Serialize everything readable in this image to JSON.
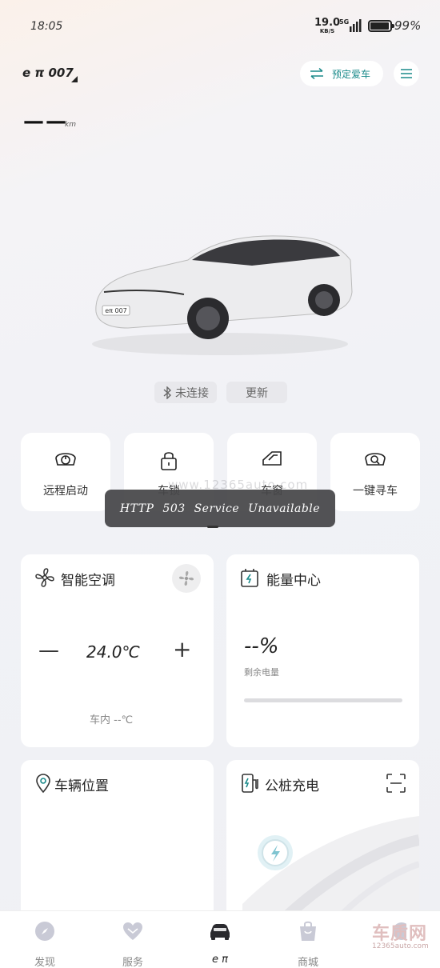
{
  "status_bar": {
    "time": "18:05",
    "net_speed": "19.0",
    "net_speed_unit": "KB/S",
    "network": "5G",
    "battery_pct": "99%"
  },
  "header": {
    "car_name": "e π 007",
    "reserve_label": "预定爱车",
    "range_value": "——",
    "range_unit": "km"
  },
  "connection": {
    "status_label": "未连接",
    "refresh_label": "更新"
  },
  "quick_actions": [
    {
      "label": "远程启动",
      "icon": "remote-start-icon"
    },
    {
      "label": "车锁",
      "icon": "lock-icon"
    },
    {
      "label": "车窗",
      "icon": "window-icon"
    },
    {
      "label": "一键寻车",
      "icon": "find-car-icon"
    }
  ],
  "toast": {
    "message": "HTTP 503 Service Unavailable"
  },
  "watermark_mid": "www.12365auto.com",
  "ac": {
    "title": "智能空调",
    "minus": "—",
    "temperature": "24.0℃",
    "plus": "+",
    "inside_label": "车内 --℃"
  },
  "energy": {
    "title": "能量中心",
    "percent": "--%",
    "remaining_label": "剩余电量"
  },
  "location": {
    "title": "车辆位置"
  },
  "charging": {
    "title": "公桩充电"
  },
  "tabs": [
    {
      "label": "发现"
    },
    {
      "label": "服务"
    },
    {
      "label": "e π"
    },
    {
      "label": "商城"
    }
  ],
  "watermark": {
    "main": "车质网",
    "sub": "12365auto.com"
  },
  "colors": {
    "accent": "#1a8a8a",
    "toast_bg": "#464648",
    "tab_active": "#222222"
  }
}
